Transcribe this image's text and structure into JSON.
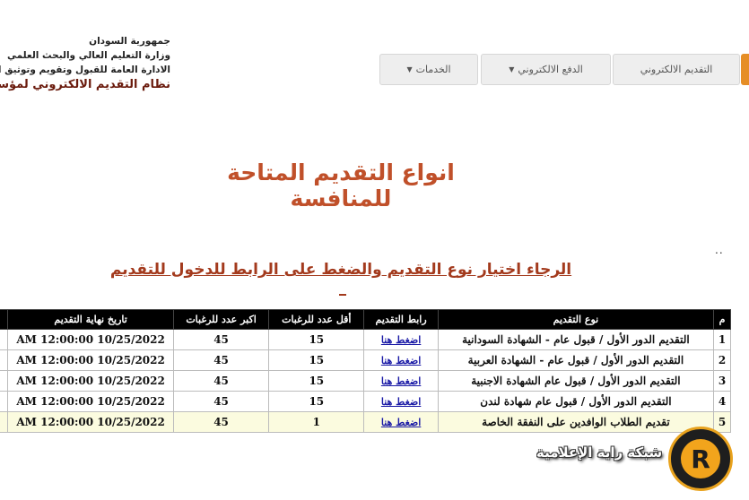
{
  "header": {
    "line1": "جمهورية السودان",
    "line2": "وزارة التعليم العالي والبحث العلمي",
    "line3": "الادارة العامة للقبول وتقويم وتوثيق الشهادات",
    "system_title": "نظام التقديم الالكتروني لمؤسسات"
  },
  "nav": {
    "apply": "التقديم الالكتروني",
    "payment": "الدفع الالكتروني",
    "services": "الخدمات",
    "caret": "▼"
  },
  "page_title": "انواع التقديم المتاحة للمنافسة",
  "dots": "..",
  "instruction": "الرجاء اختيار نوع التقديم والضغط على الرابط للدخول للتقديم",
  "table": {
    "headers": {
      "num": "م",
      "type": "نوع التقديم",
      "link": "رابط التقديم",
      "min": "أقل عدد للرغبات",
      "max": "اكبر عدد للرغبات",
      "end": "تاريخ نهاية التقديم"
    },
    "rows": [
      {
        "num": "1",
        "type": "التقديم الدور الأول / قبول عام - الشهادة السودانية",
        "link": "اضغط هنا",
        "min": "15",
        "max": "45",
        "end": "10/25/2022 12:00:00 AM"
      },
      {
        "num": "2",
        "type": "التقديم الدور الأول / قبول عام - الشهادة العربية",
        "link": "اضغط هنا",
        "min": "15",
        "max": "45",
        "end": "10/25/2022 12:00:00 AM"
      },
      {
        "num": "3",
        "type": "التقديم الدور الأول / قبول عام الشهادة الاجنبية",
        "link": "اضغط هنا",
        "min": "15",
        "max": "45",
        "end": "10/25/2022 12:00:00 AM"
      },
      {
        "num": "4",
        "type": "التقديم الدور الأول / قبول عام شهادة لندن",
        "link": "اضغط هنا",
        "min": "15",
        "max": "45",
        "end": "10/25/2022 12:00:00 AM"
      },
      {
        "num": "5",
        "type": "تقديم الطلاب الوافدين على النفقة الخاصة",
        "link": "اضغط هنا",
        "min": "1",
        "max": "45",
        "end": "10/25/2022 12:00:00 AM"
      }
    ]
  },
  "watermark": {
    "text": "شبكة راية الإعلامية",
    "logo_letter": "R"
  },
  "colors": {
    "accent_orange": "#e68e26",
    "title_red": "#c0502a",
    "header_black": "#000000",
    "link_blue": "#1a1aa6",
    "highlight_row": "#fbfbdf"
  }
}
